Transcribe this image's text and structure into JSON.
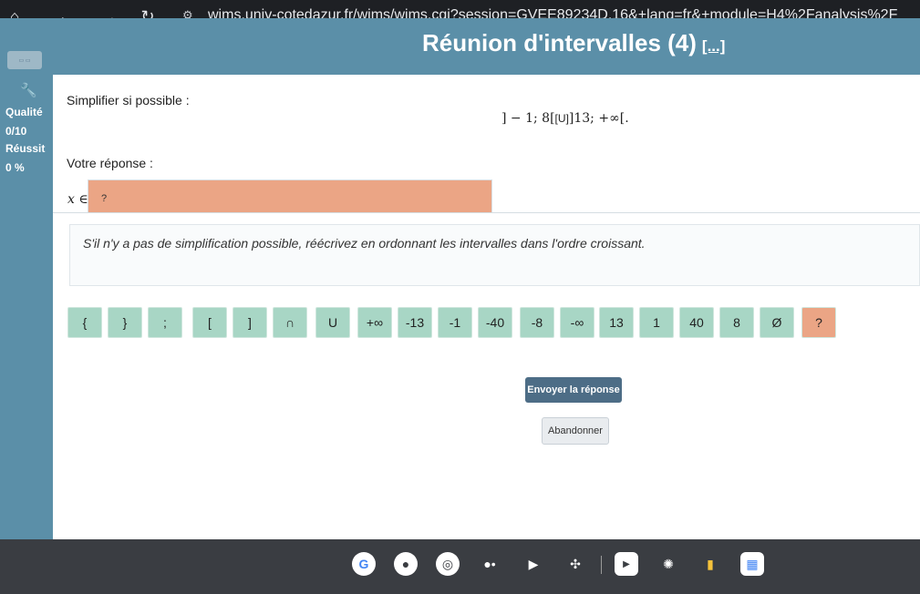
{
  "browser": {
    "url": "wims.univ-cotedazur.fr/wims/wims.cgi?session=GVEE89234D.16&+lang=fr&+module=H4%2Fanalysis%2F"
  },
  "header": {
    "title": "Réunion d'intervalles (4)",
    "more_link": "[...]"
  },
  "sidebar": {
    "quality_label": "Qualité",
    "quality_value": "0/10",
    "success_label": "Réussit",
    "success_value": "0 %"
  },
  "exercise": {
    "prompt": "Simplifier si possible :",
    "formula_left": "] − 1; 8[",
    "formula_union": "U",
    "formula_right": "]13; +∞[.",
    "answer_label": "Votre réponse :",
    "x_in": "x ∈",
    "answer_placeholder": "?",
    "hint": "S'il n'y a pas de simplification possible, réécrivez en ordonnant les intervalles dans l'ordre croissant."
  },
  "keys": [
    "{",
    "}",
    ";",
    "[",
    "]",
    "∩",
    "U",
    "+∞",
    "-13",
    "-1",
    "-40",
    "-8",
    "-∞",
    "13",
    "1",
    "40",
    "8",
    "Ø",
    "?"
  ],
  "buttons": {
    "submit": "Envoyer la réponse",
    "abandon": "Abandonner"
  },
  "colors": {
    "accent": "#5b8fa8",
    "answer_box": "#eba585",
    "key": "#a8d6c5",
    "submit": "#4d6d86"
  }
}
